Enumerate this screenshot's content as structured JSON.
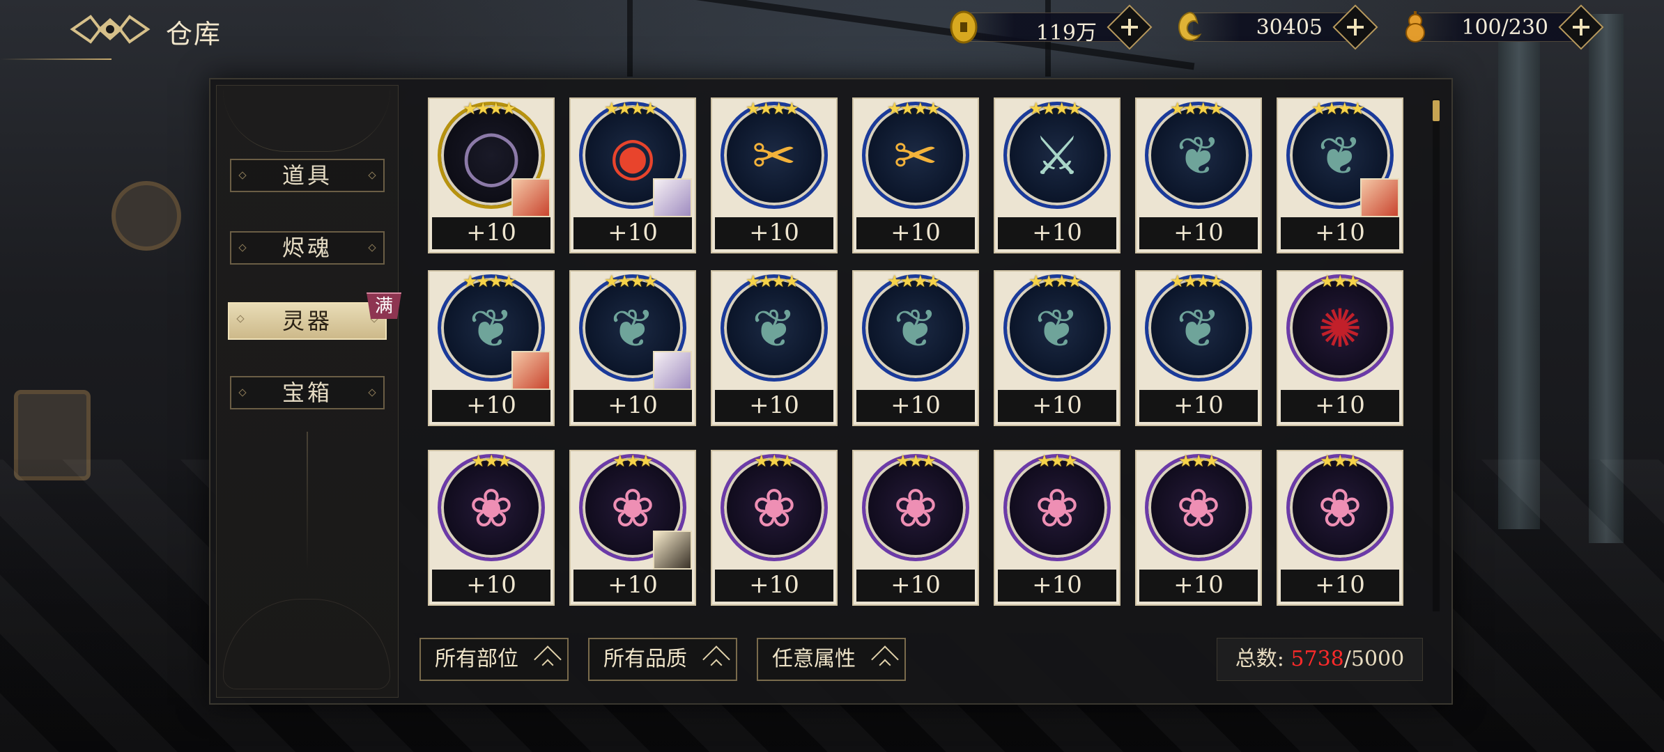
{
  "header": {
    "title": "仓库",
    "logo_icon": "winged-emblem-icon"
  },
  "currencies": [
    {
      "icon": "copper-coin-icon",
      "value": "119万"
    },
    {
      "icon": "golden-dragon-icon",
      "value": "30405"
    },
    {
      "icon": "gourd-stamina-icon",
      "value": "100/230"
    }
  ],
  "sidebar": {
    "items": [
      {
        "label": "道具",
        "active": false
      },
      {
        "label": "烬魂",
        "active": false
      },
      {
        "label": "灵器",
        "active": true
      },
      {
        "label": "宝箱",
        "active": false
      }
    ],
    "full_badge": "满"
  },
  "grid": {
    "rows": [
      [
        {
          "icon": "bead-bracelet-icon",
          "frame": "gold",
          "stars": "★★★★",
          "level": "+10",
          "avatar": "red"
        },
        {
          "icon": "flame-orb-icon",
          "frame": "blue",
          "stars": "★★★★",
          "level": "+10",
          "avatar": "white"
        },
        {
          "icon": "golden-scissors-icon",
          "frame": "blue",
          "stars": "★★★★",
          "level": "+10",
          "avatar": null
        },
        {
          "icon": "golden-scissors-icon",
          "frame": "blue",
          "stars": "★★★★",
          "level": "+10",
          "avatar": null
        },
        {
          "icon": "jade-sword-icon",
          "frame": "blue",
          "stars": "★★★★",
          "level": "+10",
          "avatar": null
        },
        {
          "icon": "jade-dragon-icon",
          "frame": "blue",
          "stars": "★★★★",
          "level": "+10",
          "avatar": null
        },
        {
          "icon": "jade-dragon-icon",
          "frame": "blue",
          "stars": "★★★★",
          "level": "+10",
          "avatar": "red"
        }
      ],
      [
        {
          "icon": "jade-dragon-icon",
          "frame": "blue",
          "stars": "★★★★",
          "level": "+10",
          "avatar": "red"
        },
        {
          "icon": "jade-dragon-icon",
          "frame": "blue",
          "stars": "★★★★",
          "level": "+10",
          "avatar": "white"
        },
        {
          "icon": "jade-dragon-icon",
          "frame": "blue",
          "stars": "★★★★",
          "level": "+10",
          "avatar": null
        },
        {
          "icon": "jade-dragon-icon",
          "frame": "blue",
          "stars": "★★★★",
          "level": "+10",
          "avatar": null
        },
        {
          "icon": "jade-dragon-icon",
          "frame": "blue",
          "stars": "★★★★",
          "level": "+10",
          "avatar": null
        },
        {
          "icon": "jade-dragon-icon",
          "frame": "blue",
          "stars": "★★★★",
          "level": "+10",
          "avatar": null
        },
        {
          "icon": "red-spider-lily-icon",
          "frame": "purple",
          "stars": "★★★",
          "level": "+10",
          "avatar": null
        }
      ],
      [
        {
          "icon": "lotus-icon",
          "frame": "purple",
          "stars": "★★★",
          "level": "+10",
          "avatar": null
        },
        {
          "icon": "lotus-icon",
          "frame": "purple",
          "stars": "★★★",
          "level": "+10",
          "avatar": "blonde"
        },
        {
          "icon": "lotus-icon",
          "frame": "purple",
          "stars": "★★★",
          "level": "+10",
          "avatar": null
        },
        {
          "icon": "lotus-icon",
          "frame": "purple",
          "stars": "★★★",
          "level": "+10",
          "avatar": null
        },
        {
          "icon": "lotus-icon",
          "frame": "purple",
          "stars": "★★★",
          "level": "+10",
          "avatar": null
        },
        {
          "icon": "lotus-icon",
          "frame": "purple",
          "stars": "★★★",
          "level": "+10",
          "avatar": null
        },
        {
          "icon": "lotus-icon",
          "frame": "purple",
          "stars": "★★★",
          "level": "+10",
          "avatar": null
        }
      ]
    ]
  },
  "filters": [
    {
      "label": "所有部位"
    },
    {
      "label": "所有品质"
    },
    {
      "label": "任意属性"
    }
  ],
  "total": {
    "label": "总数: ",
    "current": "5738",
    "max": "/5000"
  },
  "colors": {
    "over_limit": "#ff2a2a",
    "active_tab": "#e8dcb6",
    "full_badge": "#8e3551"
  }
}
